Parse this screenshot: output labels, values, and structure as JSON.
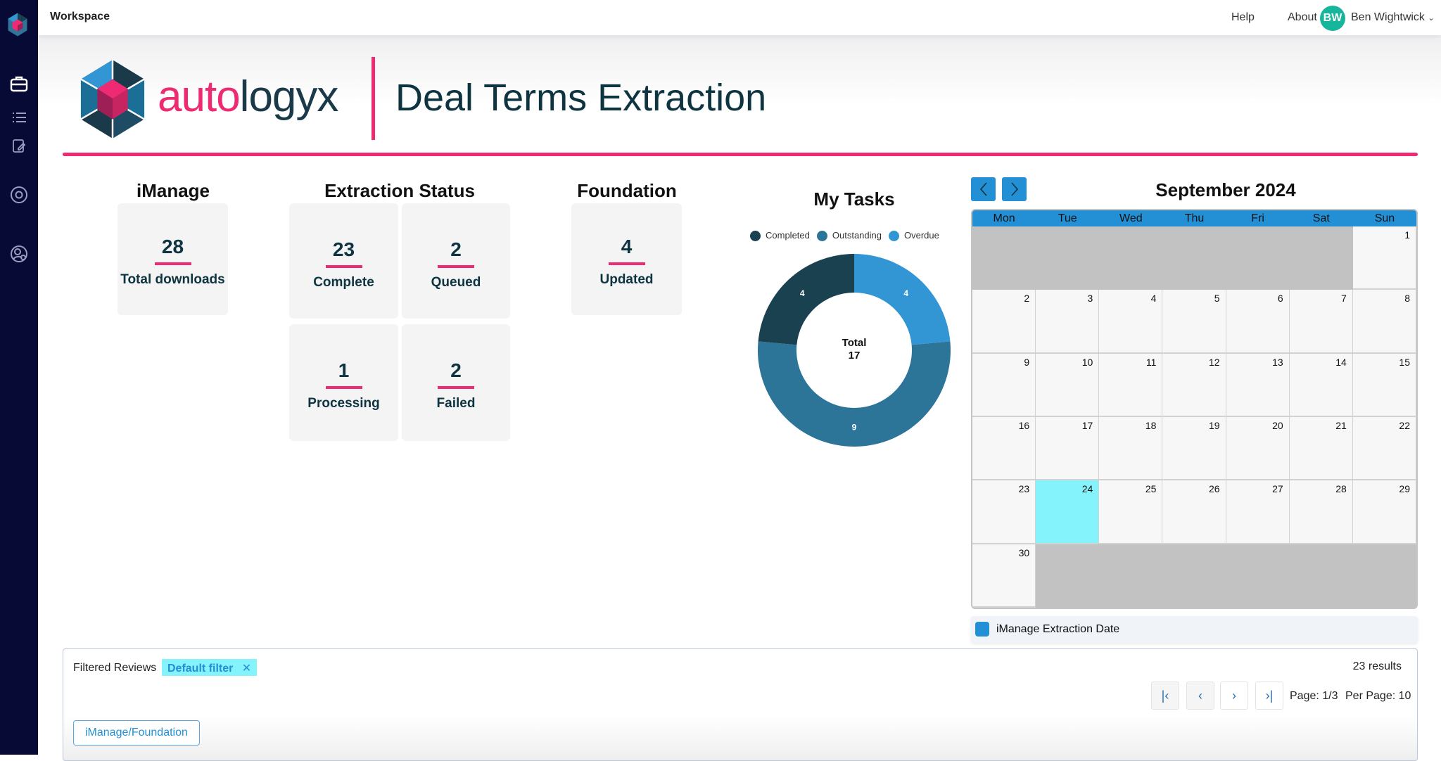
{
  "topbar": {
    "workspace": "Workspace",
    "help": "Help",
    "about": "About",
    "user_initials": "BW",
    "user_name": "Ben Wightwick"
  },
  "header": {
    "brand_part1": "auto",
    "brand_part2": "logyx",
    "title": "Deal Terms Extraction"
  },
  "imanage": {
    "heading": "iManage",
    "value": "28",
    "label": "Total downloads"
  },
  "extraction": {
    "heading": "Extraction Status",
    "cards": [
      {
        "value": "23",
        "label": "Complete"
      },
      {
        "value": "2",
        "label": "Queued"
      },
      {
        "value": "1",
        "label": "Processing"
      },
      {
        "value": "2",
        "label": "Failed"
      }
    ]
  },
  "foundation": {
    "heading": "Foundation",
    "value": "4",
    "label": "Updated"
  },
  "chart_data": {
    "type": "pie",
    "title": "My Tasks",
    "donut": true,
    "center_label": "Total",
    "center_value": "17",
    "legend_position": "top",
    "series": [
      {
        "name": "Completed",
        "value": 4,
        "color": "#1a4150"
      },
      {
        "name": "Outstanding",
        "value": 9,
        "color": "#2d7499"
      },
      {
        "name": "Overdue",
        "value": 4,
        "color": "#3196d3"
      }
    ]
  },
  "calendar": {
    "title": "September 2024",
    "weekdays": [
      "Mon",
      "Tue",
      "Wed",
      "Thu",
      "Fri",
      "Sat",
      "Sun"
    ],
    "first_weekday_offset": 6,
    "days_in_month": 30,
    "today": 24,
    "legend": "iManage Extraction Date",
    "accent": "#2390d6"
  },
  "reviews": {
    "label": "Filtered Reviews",
    "filter_chip": "Default filter",
    "results": "23 results",
    "page": "Page: 1/3",
    "per_page": "Per Page: 10",
    "tab_button": "iManage/Foundation"
  },
  "colors": {
    "brand_pink": "#ee2b72",
    "sidebar": "#080a36",
    "today": "#84f3fb"
  }
}
